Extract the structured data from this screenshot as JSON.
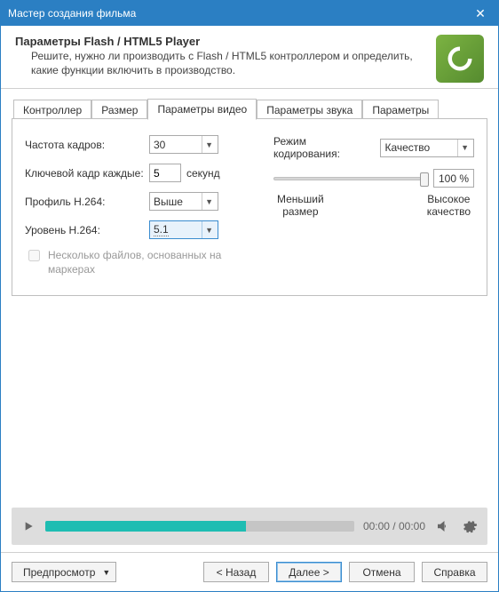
{
  "window": {
    "title": "Мастер создания фильма"
  },
  "header": {
    "title": "Параметры Flash / HTML5 Player",
    "desc": "Решите, нужно ли производить с Flash / HTML5 контроллером и определить, какие функции включить в производство."
  },
  "tabs": {
    "t0": "Контроллер",
    "t1": "Размер",
    "t2": "Параметры видео",
    "t3": "Параметры звука",
    "t4": "Параметры"
  },
  "video": {
    "framerate_label": "Частота кадров:",
    "framerate_value": "30",
    "keyframe_label": "Ключевой кадр каждые:",
    "keyframe_value": "5",
    "keyframe_unit": "секунд",
    "profile_label": "Профиль H.264:",
    "profile_value": "Выше",
    "level_label": "Уровень H.264:",
    "level_value": "5.1",
    "multi_files_label": "Несколько файлов, основанных на маркерах"
  },
  "encoding": {
    "mode_label": "Режим кодирования:",
    "mode_value": "Качество",
    "percent": "100 %",
    "left_label_1": "Меньший",
    "left_label_2": "размер",
    "right_label_1": "Высокое",
    "right_label_2": "качество"
  },
  "player": {
    "time": "00:00 / 00:00"
  },
  "footer": {
    "preview": "Предпросмотр",
    "back": "< Назад",
    "next": "Далее >",
    "cancel": "Отмена",
    "help": "Справка"
  }
}
